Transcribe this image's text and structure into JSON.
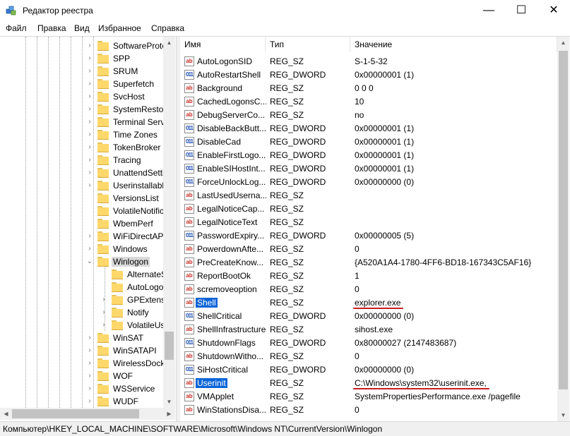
{
  "window": {
    "title": "Редактор реестра",
    "minimize": "—",
    "maximize": "☐",
    "close": "✕"
  },
  "menu": [
    "Файл",
    "Правка",
    "Вид",
    "Избранное",
    "Справка"
  ],
  "tree": {
    "items": [
      {
        "label": "SoftwareProte",
        "expander": "›",
        "level": 0
      },
      {
        "label": "SPP",
        "expander": "›",
        "level": 0
      },
      {
        "label": "SRUM",
        "expander": "›",
        "level": 0
      },
      {
        "label": "Superfetch",
        "expander": "›",
        "level": 0
      },
      {
        "label": "SvcHost",
        "expander": "›",
        "level": 0
      },
      {
        "label": "SystemRestor",
        "expander": "›",
        "level": 0
      },
      {
        "label": "Terminal Serv",
        "expander": "›",
        "level": 0
      },
      {
        "label": "Time Zones",
        "expander": "›",
        "level": 0
      },
      {
        "label": "TokenBroker",
        "expander": "›",
        "level": 0
      },
      {
        "label": "Tracing",
        "expander": "›",
        "level": 0
      },
      {
        "label": "UnattendSetti",
        "expander": "›",
        "level": 0
      },
      {
        "label": "Userinstallabl",
        "expander": "›",
        "level": 0
      },
      {
        "label": "VersionsList",
        "expander": "",
        "level": 0
      },
      {
        "label": "VolatileNotific",
        "expander": "",
        "level": 0
      },
      {
        "label": "WbemPerf",
        "expander": "",
        "level": 0
      },
      {
        "label": "WiFiDirectAPI",
        "expander": "›",
        "level": 0
      },
      {
        "label": "Windows",
        "expander": "›",
        "level": 0
      },
      {
        "label": "Winlogon",
        "expander": "⌄",
        "level": 0,
        "selected": true
      },
      {
        "label": "AlternateS",
        "expander": "",
        "level": 1
      },
      {
        "label": "AutoLogo",
        "expander": "",
        "level": 1
      },
      {
        "label": "GPExtensi",
        "expander": "›",
        "level": 1
      },
      {
        "label": "Notify",
        "expander": "›",
        "level": 1
      },
      {
        "label": "VolatileUs",
        "expander": "›",
        "level": 1
      },
      {
        "label": "WinSAT",
        "expander": "›",
        "level": 0
      },
      {
        "label": "WinSATAPI",
        "expander": "›",
        "level": 0
      },
      {
        "label": "WirelessDock",
        "expander": "›",
        "level": 0
      },
      {
        "label": "WOF",
        "expander": "›",
        "level": 0
      },
      {
        "label": "WSService",
        "expander": "›",
        "level": 0
      },
      {
        "label": "WUDF",
        "expander": "›",
        "level": 0
      }
    ]
  },
  "list": {
    "columns": [
      "Имя",
      "Тип",
      "Значение"
    ],
    "rows": [
      {
        "icon": "ab",
        "name": "AutoLogonSID",
        "type": "REG_SZ",
        "value": "S-1-5-32"
      },
      {
        "icon": "dw",
        "name": "AutoRestartShell",
        "type": "REG_DWORD",
        "value": "0x00000001 (1)"
      },
      {
        "icon": "ab",
        "name": "Background",
        "type": "REG_SZ",
        "value": "0 0 0"
      },
      {
        "icon": "ab",
        "name": "CachedLogonsC...",
        "type": "REG_SZ",
        "value": "10"
      },
      {
        "icon": "ab",
        "name": "DebugServerCo...",
        "type": "REG_SZ",
        "value": "no"
      },
      {
        "icon": "dw",
        "name": "DisableBackButt...",
        "type": "REG_DWORD",
        "value": "0x00000001 (1)"
      },
      {
        "icon": "dw",
        "name": "DisableCad",
        "type": "REG_DWORD",
        "value": "0x00000001 (1)"
      },
      {
        "icon": "dw",
        "name": "EnableFirstLogo...",
        "type": "REG_DWORD",
        "value": "0x00000001 (1)"
      },
      {
        "icon": "dw",
        "name": "EnableSIHostInt...",
        "type": "REG_DWORD",
        "value": "0x00000001 (1)"
      },
      {
        "icon": "dw",
        "name": "ForceUnlockLog...",
        "type": "REG_DWORD",
        "value": "0x00000000 (0)"
      },
      {
        "icon": "ab",
        "name": "LastUsedUserna...",
        "type": "REG_SZ",
        "value": ""
      },
      {
        "icon": "ab",
        "name": "LegalNoticeCap...",
        "type": "REG_SZ",
        "value": ""
      },
      {
        "icon": "ab",
        "name": "LegalNoticeText",
        "type": "REG_SZ",
        "value": ""
      },
      {
        "icon": "dw",
        "name": "PasswordExpiry...",
        "type": "REG_DWORD",
        "value": "0x00000005 (5)"
      },
      {
        "icon": "ab",
        "name": "PowerdownAfte...",
        "type": "REG_SZ",
        "value": "0"
      },
      {
        "icon": "ab",
        "name": "PreCreateKnow...",
        "type": "REG_SZ",
        "value": "{A520A1A4-1780-4FF6-BD18-167343C5AF16}"
      },
      {
        "icon": "ab",
        "name": "ReportBootOk",
        "type": "REG_SZ",
        "value": "1"
      },
      {
        "icon": "ab",
        "name": "scremoveoption",
        "type": "REG_SZ",
        "value": "0"
      },
      {
        "icon": "ab",
        "name": "Shell",
        "type": "REG_SZ",
        "value": "explorer.exe",
        "selected": true,
        "marked": true
      },
      {
        "icon": "dw",
        "name": "ShellCritical",
        "type": "REG_DWORD",
        "value": "0x00000000 (0)"
      },
      {
        "icon": "ab",
        "name": "ShellInfrastructure",
        "type": "REG_SZ",
        "value": "sihost.exe"
      },
      {
        "icon": "dw",
        "name": "ShutdownFlags",
        "type": "REG_DWORD",
        "value": "0x80000027 (2147483687)"
      },
      {
        "icon": "ab",
        "name": "ShutdownWitho...",
        "type": "REG_SZ",
        "value": "0"
      },
      {
        "icon": "dw",
        "name": "SiHostCritical",
        "type": "REG_DWORD",
        "value": "0x00000000 (0)"
      },
      {
        "icon": "ab",
        "name": "Userinit",
        "type": "REG_SZ",
        "value": "C:\\Windows\\system32\\userinit.exe,",
        "selected": true,
        "marked": true
      },
      {
        "icon": "ab",
        "name": "VMApplet",
        "type": "REG_SZ",
        "value": "SystemPropertiesPerformance.exe /pagefile"
      },
      {
        "icon": "ab",
        "name": "WinStationsDisa...",
        "type": "REG_SZ",
        "value": "0"
      }
    ]
  },
  "status": {
    "path": "Компьютер\\HKEY_LOCAL_MACHINE\\SOFTWARE\\Microsoft\\Windows NT\\CurrentVersion\\Winlogon"
  },
  "colors": {
    "selection": "#0a64d8",
    "mark": "#c81e1e",
    "folder": "#ffd86b"
  }
}
